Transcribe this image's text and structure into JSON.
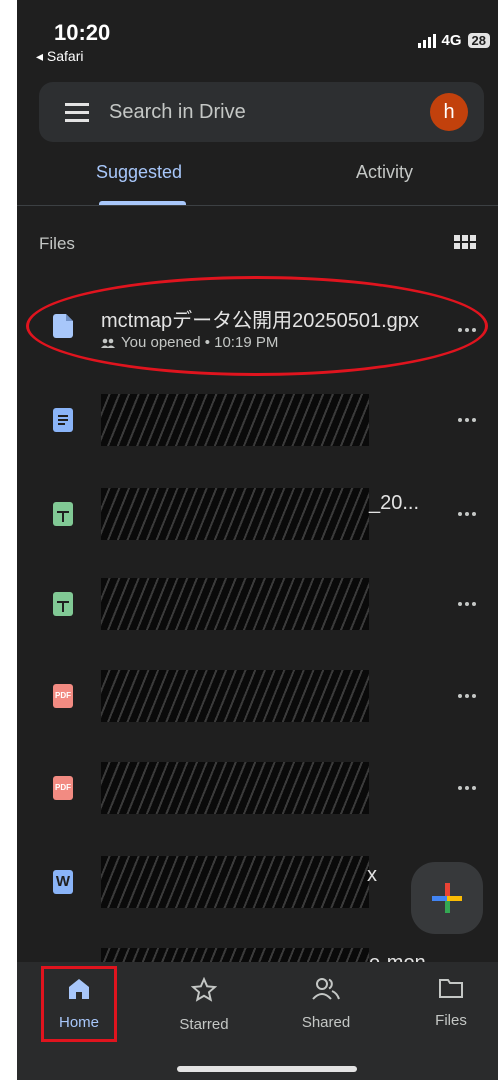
{
  "status_bar": {
    "time": "10:20",
    "back_app": "◂ Safari",
    "network": "4G",
    "battery": "28"
  },
  "search": {
    "placeholder": "Search in Drive",
    "avatar_letter": "h"
  },
  "tabs": [
    {
      "label": "Suggested",
      "selected": true
    },
    {
      "label": "Activity",
      "selected": false
    }
  ],
  "section_label": "Files",
  "files": [
    {
      "name": "mctmapデータ公開用20250501.gpx",
      "meta": "You opened • 10:19 PM",
      "icon": "file-icon",
      "color": "#a8c7fa",
      "redacted": false
    },
    {
      "name": "",
      "suffix": "",
      "icon": "docs-icon",
      "color": "#8ab4f8",
      "redacted": true
    },
    {
      "name": "",
      "suffix": "_20...",
      "icon": "sheets-icon",
      "color": "#81c995",
      "redacted": true
    },
    {
      "name": "",
      "suffix": "",
      "icon": "sheets-icon",
      "color": "#81c995",
      "redacted": true
    },
    {
      "name": "",
      "suffix": "",
      "icon": "pdf-icon",
      "color": "#f28b82",
      "redacted": true
    },
    {
      "name": "",
      "suffix": "",
      "icon": "pdf-icon",
      "color": "#f28b82",
      "redacted": true
    },
    {
      "name": "",
      "suffix": "x",
      "icon": "word-icon",
      "color": "#8ab4f8",
      "redacted": true
    },
    {
      "name": "",
      "suffix": "o-mon",
      "icon": "sheets-icon",
      "color": "#81c995",
      "redacted": true
    }
  ],
  "icon_labels": {
    "pdf": "PDF",
    "word": "W"
  },
  "bottom_nav": [
    {
      "label": "Home",
      "icon": "home-icon",
      "active": true
    },
    {
      "label": "Starred",
      "icon": "star-icon",
      "active": false
    },
    {
      "label": "Shared",
      "icon": "people-icon",
      "active": false
    },
    {
      "label": "Files",
      "icon": "folder-icon",
      "active": false
    }
  ],
  "colors": {
    "accent": "#a8c7fa",
    "background": "#1f1f1f",
    "highlight": "#e0141e"
  }
}
